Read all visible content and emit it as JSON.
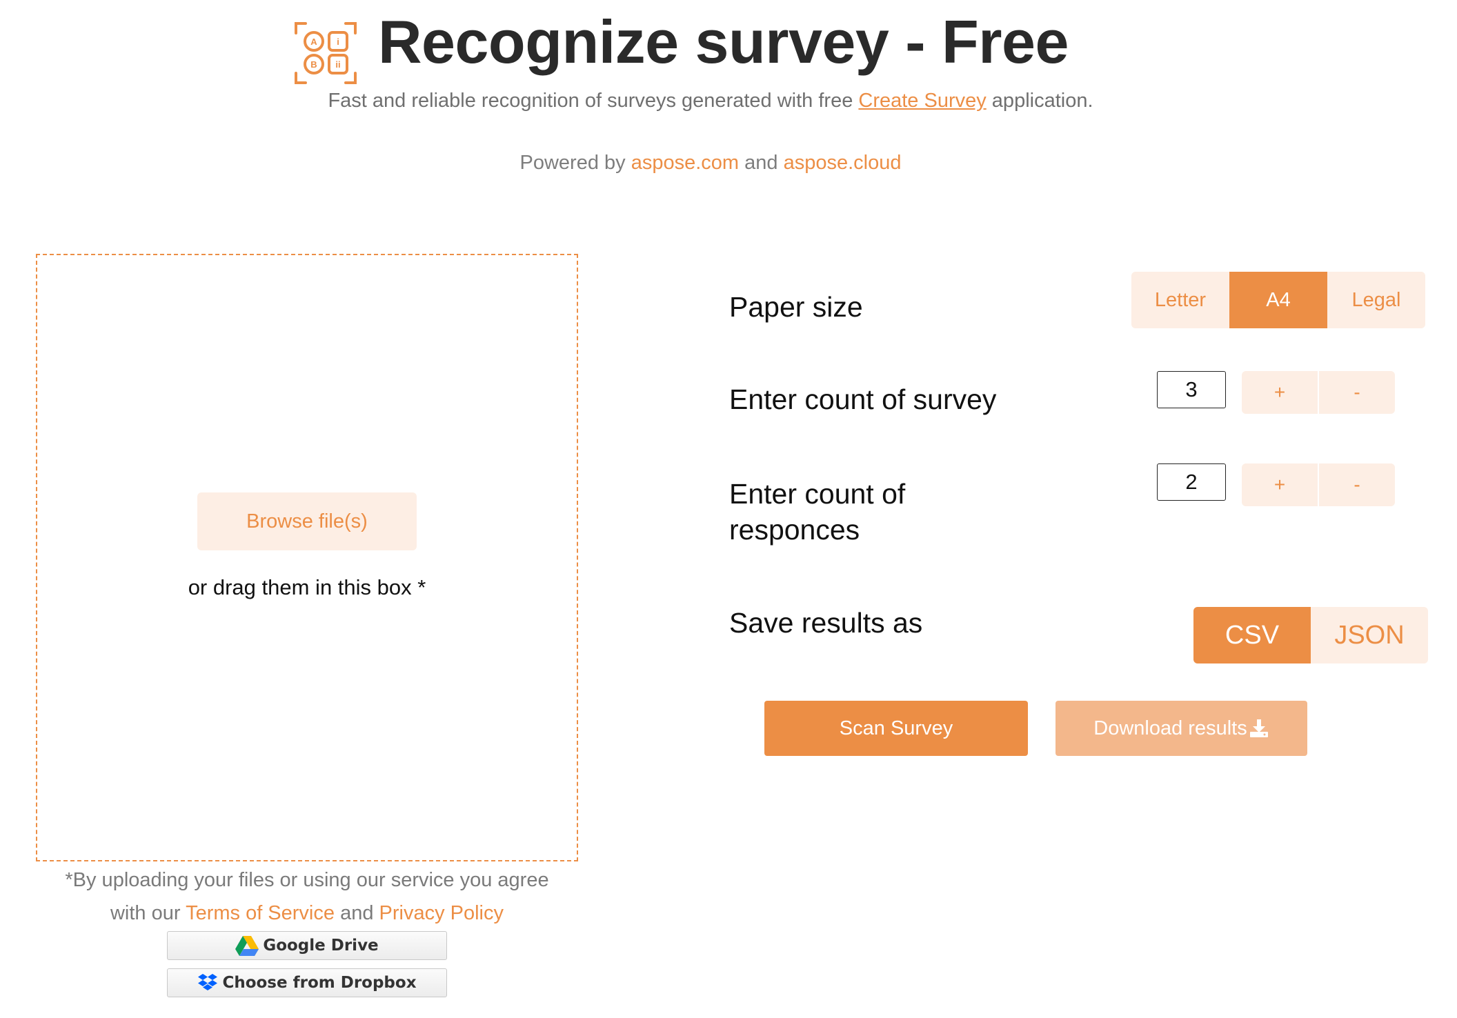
{
  "header": {
    "title": "Recognize survey - Free",
    "subtitle_before": "Fast and reliable recognition of surveys generated with free ",
    "subtitle_link": "Create Survey",
    "subtitle_after": " application.",
    "powered_prefix": "Powered by ",
    "powered_link1": "aspose.com",
    "powered_mid": " and ",
    "powered_link2": "aspose.cloud",
    "logo_letters": [
      "A",
      "i",
      "B",
      "ii"
    ]
  },
  "upload": {
    "browse_label": "Browse file(s)",
    "drag_text": "or drag them in this box *",
    "agree_line1": "*By uploading your files or using our service you agree",
    "agree_prefix": "with our ",
    "terms_link": "Terms of Service",
    "agree_mid": " and ",
    "privacy_link": "Privacy Policy",
    "google_drive_label": "Google Drive",
    "dropbox_label": "Choose from Dropbox"
  },
  "settings": {
    "paper_size_label": "Paper size",
    "paper_options": [
      "Letter",
      "A4",
      "Legal"
    ],
    "paper_selected": "A4",
    "survey_count_label": "Enter count of survey",
    "survey_count": "3",
    "responses_count_label": "Enter count of responces",
    "responses_count": "2",
    "plus_label": "+",
    "minus_label": "-",
    "save_label": "Save results as",
    "save_options": [
      "CSV",
      "JSON"
    ],
    "save_selected": "CSV"
  },
  "actions": {
    "scan_label": "Scan Survey",
    "download_label": "Download results"
  },
  "colors": {
    "accent": "#ec8e45",
    "accent_light": "#fdeee4",
    "accent_disabled": "#f3b78b"
  },
  "icons": {
    "logo": "survey-logo-icon",
    "download": "download-icon",
    "google_drive": "google-drive-icon",
    "dropbox": "dropbox-icon"
  }
}
